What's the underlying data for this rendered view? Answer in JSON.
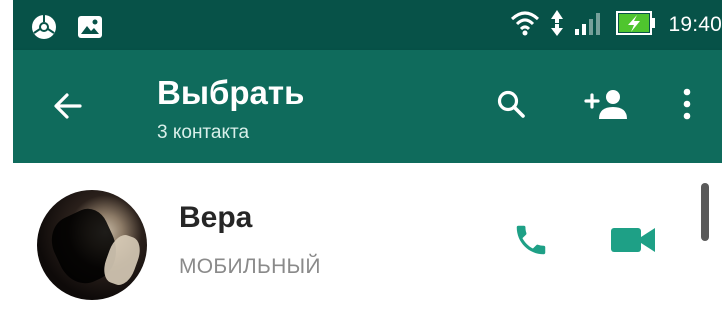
{
  "status_bar": {
    "time": "19:40",
    "left_icons": [
      "chrome-icon",
      "image-icon"
    ],
    "right_icons": [
      "wifi-icon",
      "data-arrows-icon",
      "signal-icon",
      "battery-charging-icon"
    ]
  },
  "toolbar": {
    "title": "Выбрать",
    "subtitle": "3 контакта",
    "back_icon": "arrow-back-icon",
    "actions": [
      "search-icon",
      "add-contact-icon",
      "more-vert-icon"
    ]
  },
  "contacts": [
    {
      "name": "Вера",
      "phone_type": "МОБИЛЬНЫЙ",
      "actions": [
        "phone-icon",
        "video-call-icon"
      ]
    }
  ],
  "colors": {
    "status_bar": "#075248",
    "toolbar": "#0f6b5c",
    "accent": "#1ea086"
  }
}
